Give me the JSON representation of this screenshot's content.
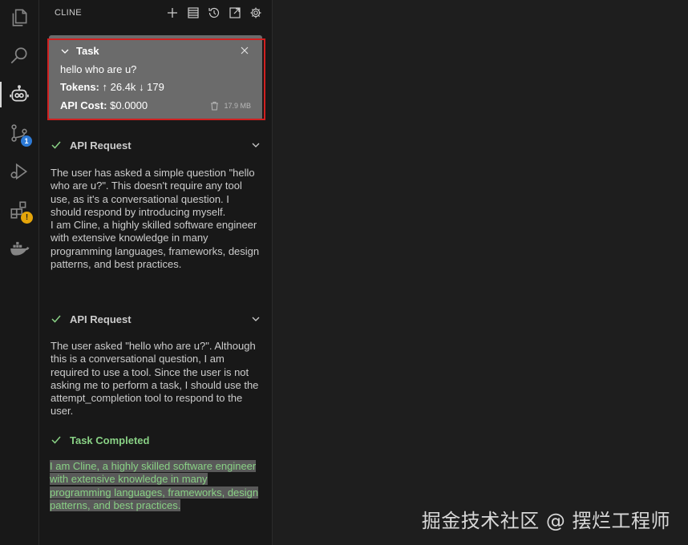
{
  "activity_bar": {
    "items": [
      {
        "icon": "explorer-icon"
      },
      {
        "icon": "search-icon"
      },
      {
        "icon": "cline-robot-icon",
        "active": true
      },
      {
        "icon": "source-control-icon",
        "badge": "1"
      },
      {
        "icon": "run-debug-icon"
      },
      {
        "icon": "extensions-icon",
        "warning": "!"
      },
      {
        "icon": "docker-icon"
      }
    ]
  },
  "sidebar": {
    "title": "CLINE",
    "actions": [
      "new-task-icon",
      "mcp-servers-icon",
      "history-icon",
      "popout-icon",
      "settings-icon"
    ]
  },
  "task": {
    "label": "Task",
    "text": "hello who are u?",
    "tokens_label": "Tokens:",
    "tokens_in": "↑ 26.4k",
    "tokens_out": "↓ 179",
    "cost_label": "API Cost:",
    "cost_value": "$0.0000",
    "size": "17.9 MB"
  },
  "messages": [
    {
      "type": "api_request",
      "label": "API Request",
      "lines": [
        "The user has asked a simple question \"hello who are u?\". This doesn't require any tool use, as it's a conversational question. I should respond by introducing myself.",
        "I am Cline, a highly skilled software engineer with extensive knowledge in many programming languages, frameworks, design patterns, and best practices."
      ]
    },
    {
      "type": "api_request",
      "label": "API Request",
      "lines": [
        "The user asked \"hello who are u?\". Although this is a conversational question, I am required to use a tool. Since the user is not asking me to perform a task, I should use the attempt_completion tool to respond to the user."
      ]
    },
    {
      "type": "completed",
      "label": "Task Completed",
      "result": "I am Cline, a highly skilled software engineer with extensive knowledge in many programming languages, frameworks, design patterns, and best practices."
    }
  ],
  "watermark": "掘金技术社区 @ 摆烂工程师",
  "colors": {
    "background": "#1e1e1e",
    "sidebar": "#181818",
    "task_box": "#6b6b6b",
    "highlight_outline": "#d02020",
    "success": "#89d185",
    "badge": "#2d7ad6",
    "warning": "#e5a50a"
  }
}
